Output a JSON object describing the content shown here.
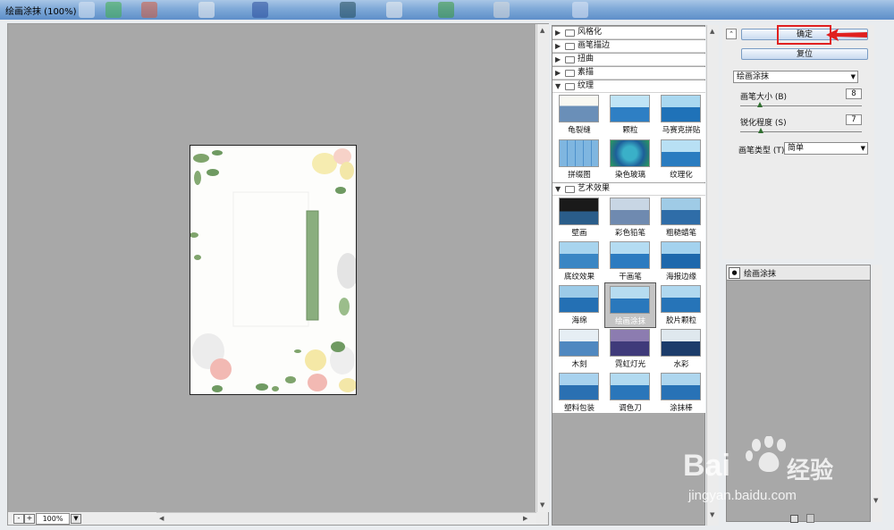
{
  "window": {
    "title": "绘画涂抹 (100%)"
  },
  "preview": {
    "zoom": "100%",
    "zoom_out": "-",
    "zoom_in": "+"
  },
  "filter_categories": [
    {
      "label": "风格化",
      "expanded": false
    },
    {
      "label": "画笔描边",
      "expanded": false
    },
    {
      "label": "扭曲",
      "expanded": false
    },
    {
      "label": "素描",
      "expanded": false
    },
    {
      "label": "纹理",
      "expanded": true
    },
    {
      "label": "艺术效果",
      "expanded": true
    }
  ],
  "texture_filters": [
    "龟裂缝",
    "颗粒",
    "马赛克拼贴",
    "拼缀图",
    "染色玻璃",
    "纹理化"
  ],
  "artistic_filters": [
    "壁画",
    "彩色铅笔",
    "粗糙蜡笔",
    "底纹效果",
    "干画笔",
    "海报边缘",
    "海绵",
    "绘画涂抹",
    "胶片颗粒",
    "木刻",
    "霓虹灯光",
    "水彩",
    "塑料包装",
    "调色刀",
    "涂抹棒"
  ],
  "selected_filter": "绘画涂抹",
  "buttons": {
    "ok": "确定",
    "reset": "复位"
  },
  "settings": {
    "filter_select": "绘画涂抹",
    "brush_size_label": "画笔大小 (B)",
    "brush_size_value": "8",
    "brush_size_level": 0.16,
    "sharpness_label": "锐化程度 (S)",
    "sharpness_value": "7",
    "sharpness_level": 0.17,
    "brush_type_label": "画笔类型 (T):",
    "brush_type_value": "简单"
  },
  "effect_layers": [
    {
      "name": "绘画涂抹"
    }
  ],
  "watermark": {
    "brand": "Bai",
    "brand2": "经验",
    "url": "jingyan.baidu.com"
  },
  "colors": {
    "highlight": "#e02020",
    "window_bg": "#a8a8a8"
  }
}
